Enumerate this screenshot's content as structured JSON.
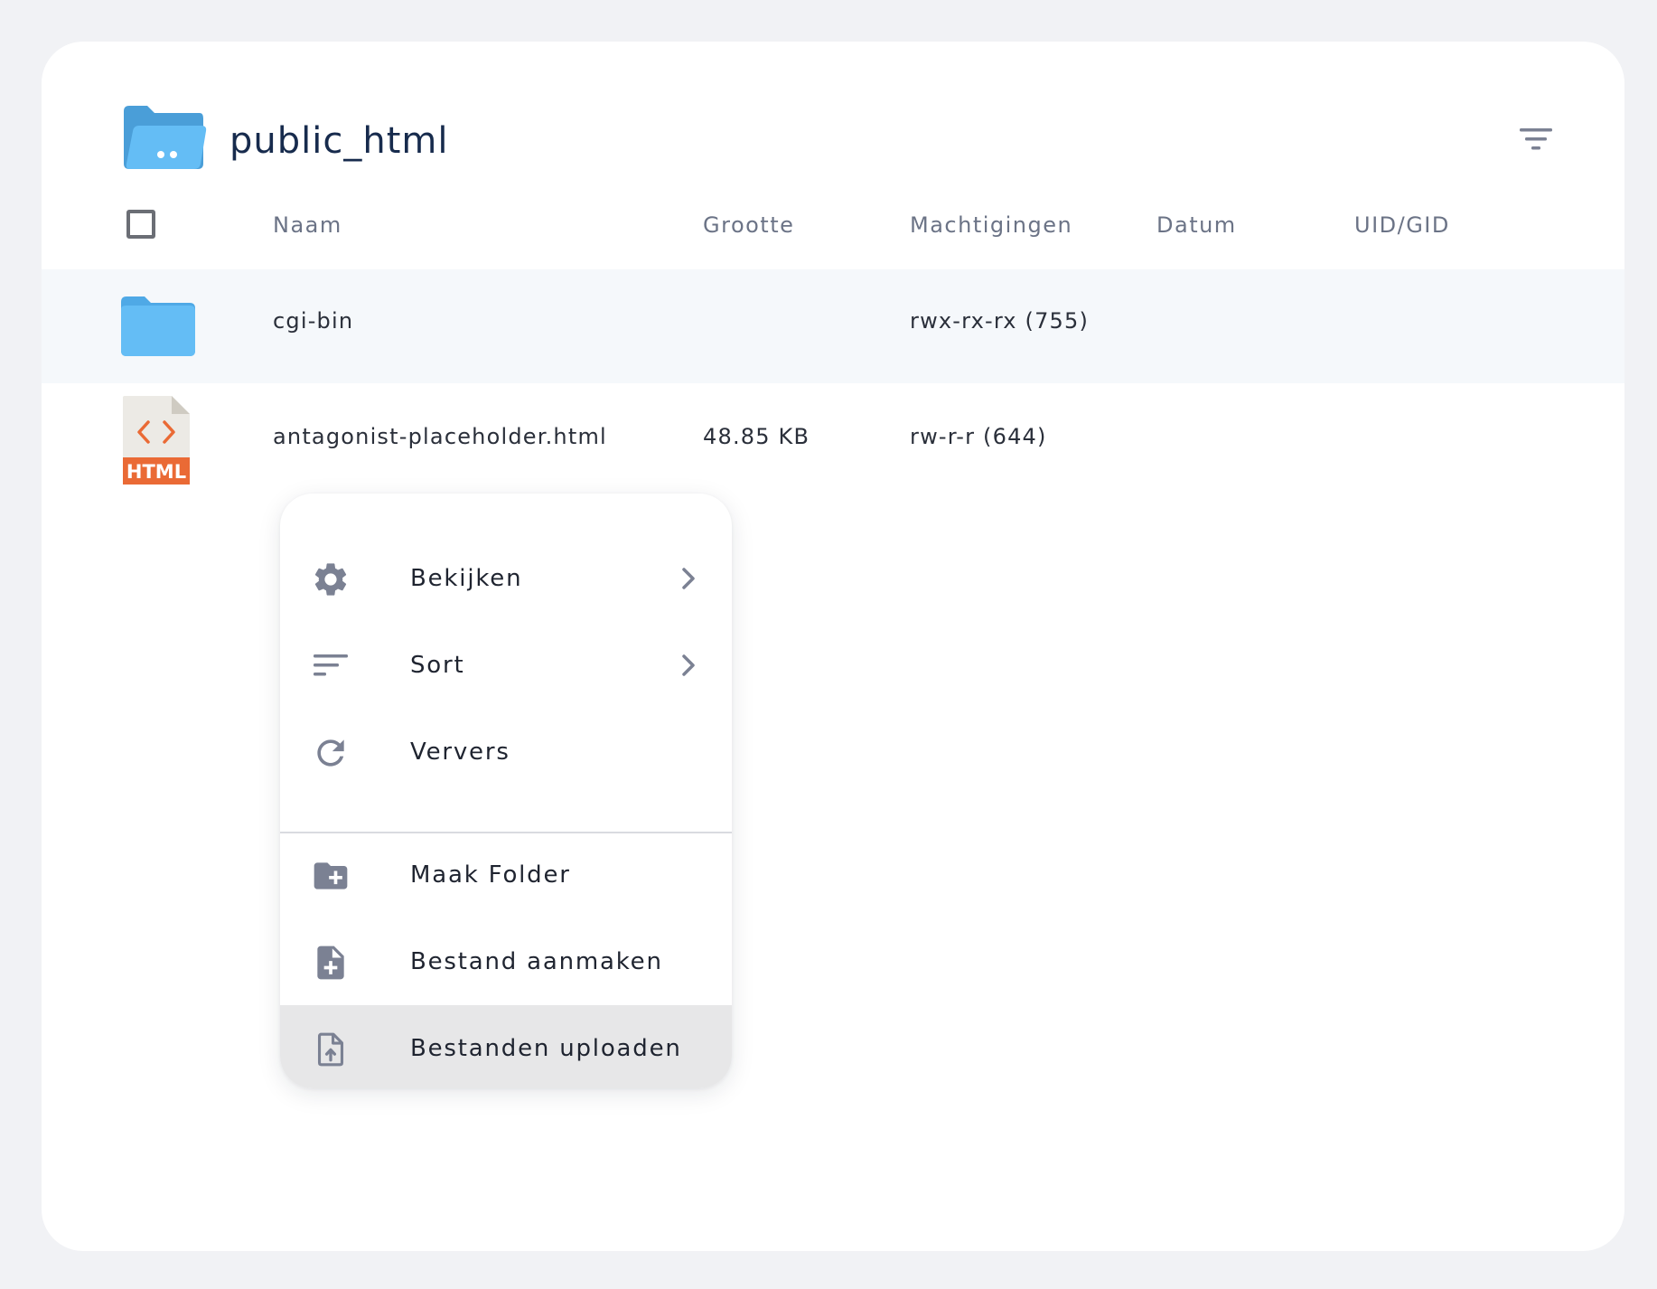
{
  "header": {
    "title": "public_html",
    "folder_icon": "folder-open-icon",
    "filter_icon": "filter-icon"
  },
  "columns": {
    "name": "Naam",
    "size": "Grootte",
    "permissions": "Machtigingen",
    "date": "Datum",
    "owner": "UID/GID"
  },
  "files": [
    {
      "icon": "folder-icon",
      "name": "cgi-bin",
      "size": "",
      "permissions": "rwx-rx-rx (755)",
      "date": "",
      "owner": ""
    },
    {
      "icon": "html-file-icon",
      "icon_text": "HTML",
      "name": "antagonist-placeholder.html",
      "size": "48.85 KB",
      "permissions": "rw-r-r (644)",
      "date": "",
      "owner": ""
    }
  ],
  "context_menu": {
    "items": [
      {
        "label": "Bekijken",
        "icon": "gear-icon",
        "has_submenu": true
      },
      {
        "label": "Sort",
        "icon": "sort-icon",
        "has_submenu": true
      },
      {
        "label": "Ververs",
        "icon": "refresh-icon",
        "has_submenu": false
      },
      {
        "label": "Maak Folder",
        "icon": "folder-plus-icon",
        "has_submenu": false
      },
      {
        "label": "Bestand aanmaken",
        "icon": "file-plus-icon",
        "has_submenu": false
      },
      {
        "label": "Bestanden uploaden",
        "icon": "file-upload-icon",
        "has_submenu": false,
        "highlighted": true
      }
    ]
  },
  "colors": {
    "title": "#172b4d",
    "folder_blue": "#64bdf5",
    "folder_blue_dark": "#4a9ed8",
    "html_orange": "#ea6a35",
    "menu_icon_gray": "#7b8193",
    "row_shade": "#f5f8fb",
    "menu_highlight": "#e7e7e8"
  }
}
